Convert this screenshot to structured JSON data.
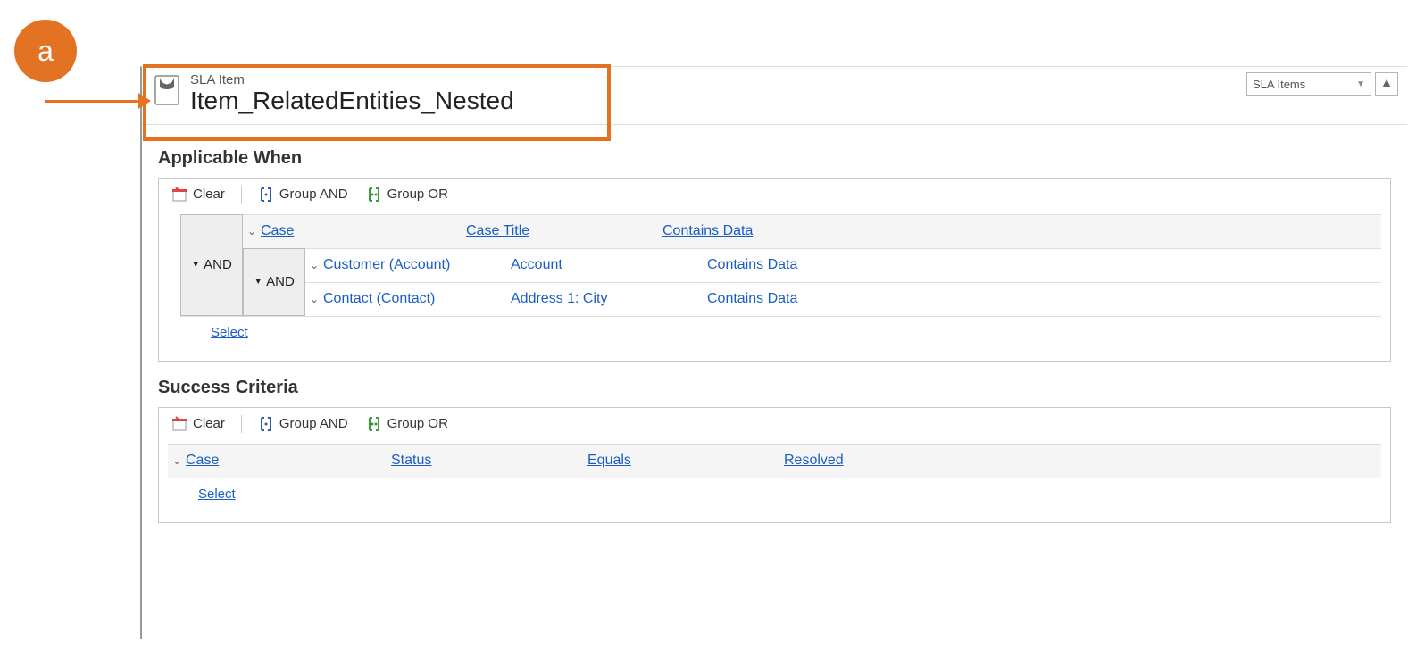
{
  "callout": {
    "letter": "a"
  },
  "header": {
    "entity_type": "SLA Item",
    "title": "Item_RelatedEntities_Nested",
    "navigator_selected": "SLA Items"
  },
  "sections": {
    "applicable_when": {
      "title": "Applicable When",
      "toolbar": {
        "clear": "Clear",
        "group_and": "Group AND",
        "group_or": "Group OR"
      },
      "outer_group_op": "AND",
      "outer_row": {
        "entity": "Case",
        "field": "Case Title",
        "operator": "Contains Data"
      },
      "inner_group_op": "AND",
      "inner_rows": [
        {
          "entity": "Customer (Account)",
          "field": "Account",
          "operator": "Contains Data"
        },
        {
          "entity": "Contact (Contact)",
          "field": "Address 1: City",
          "operator": "Contains Data"
        }
      ],
      "select": "Select"
    },
    "success_criteria": {
      "title": "Success Criteria",
      "toolbar": {
        "clear": "Clear",
        "group_and": "Group AND",
        "group_or": "Group OR"
      },
      "row": {
        "entity": "Case",
        "field": "Status",
        "operator": "Equals",
        "value": "Resolved"
      },
      "select": "Select"
    }
  }
}
